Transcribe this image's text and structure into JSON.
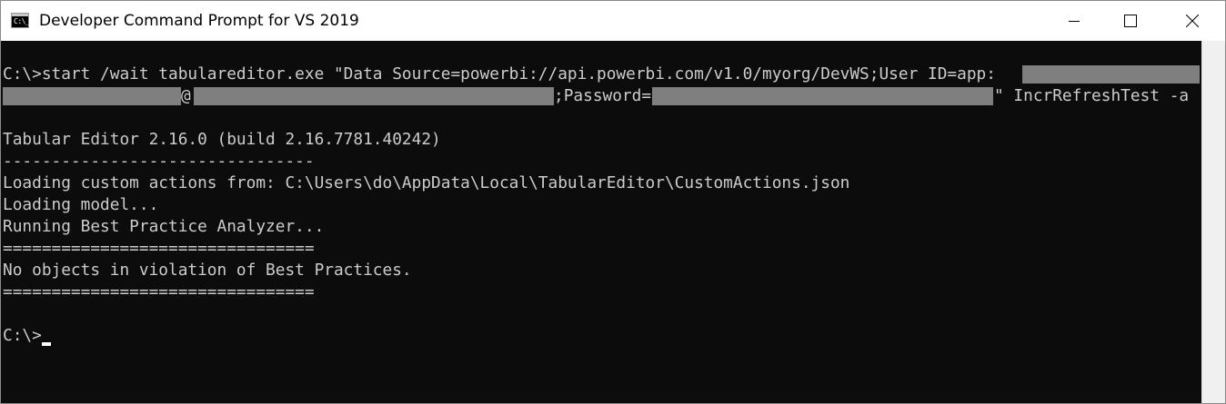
{
  "window": {
    "title": "Developer Command Prompt for VS 2019",
    "icon": "console-icon",
    "icon_glyph": "C:\\_",
    "controls": [
      "minimize-icon",
      "maximize-icon",
      "close-icon"
    ]
  },
  "console": {
    "background": "#0c0c0c",
    "foreground": "#cccccc",
    "lines": {
      "cmd_1": "C:\\>start /wait tabulareditor.exe \"Data Source=powerbi://api.powerbi.com/v1.0/myorg/DevWS;User ID=app:",
      "cmd_2_at": "@",
      "cmd_2_pw": ";Password=",
      "cmd_2_end": "\" IncrRefreshTest -a",
      "version": "Tabular Editor 2.16.0 (build 2.16.7781.40242)",
      "sep_dash": "--------------------------------",
      "loading_actions": "Loading custom actions from: C:\\Users\\do\\AppData\\Local\\TabularEditor\\CustomActions.json",
      "loading_model": "Loading model...",
      "running_bpa": "Running Best Practice Analyzer...",
      "sep_eq_1": "================================",
      "no_violations": "No objects in violation of Best Practices.",
      "sep_eq_2": "================================",
      "prompt": "C:\\>"
    }
  }
}
